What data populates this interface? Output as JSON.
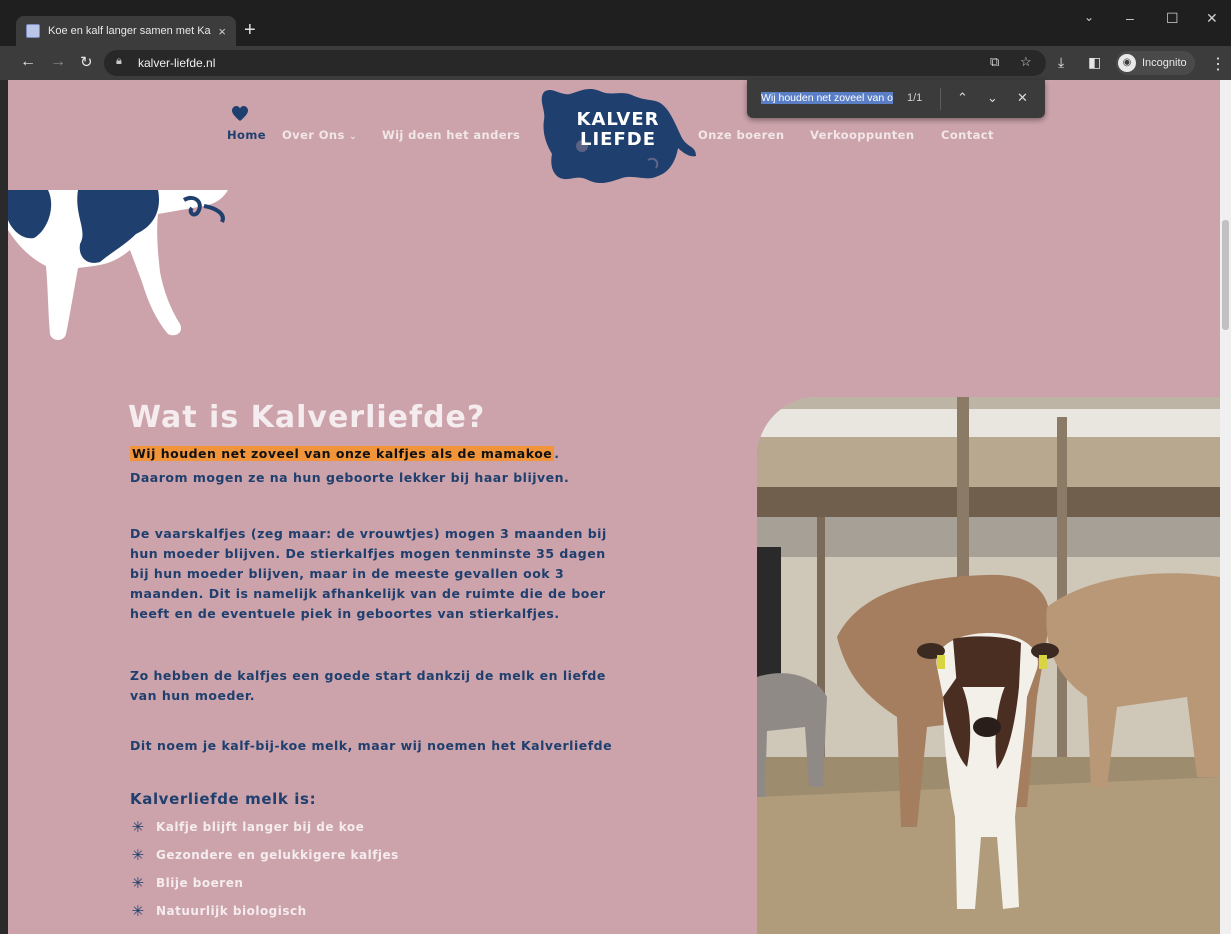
{
  "browser": {
    "tab_title": "Koe en kalf langer samen met Ka",
    "tab_close": "×",
    "new_tab": "+",
    "url": "kalver-liefde.nl",
    "profile_label": "Incognito",
    "window_controls": {
      "dropdown": "⌄",
      "minimize": "–",
      "maximize": "☐",
      "close": "✕"
    }
  },
  "find_bar": {
    "query": "Wij houden net zoveel van o",
    "count": "1/1"
  },
  "nav": {
    "home": "Home",
    "over_ons": "Over Ons",
    "wij_doen": "Wij doen het anders",
    "boeren": "Onze boeren",
    "verkoop": "Verkooppunten",
    "contact": "Contact"
  },
  "logo": {
    "line1": "KALVER",
    "line2": "LIEFDE"
  },
  "content": {
    "heading": "Wat is Kalverliefde?",
    "highlight": "Wij houden net zoveel van onze kalfjes als de mamakoe",
    "highlight_end": ".",
    "p1_line2": "Daarom mogen ze na hun geboorte lekker bij haar blijven.",
    "p2": [
      "De vaarskalfjes (zeg maar: de vrouwtjes) mogen 3 maanden bij",
      "hun moeder blijven. De stierkalfjes mogen tenminste 35 dagen",
      "bij hun moeder blijven, maar in de meeste gevallen ook 3",
      "maanden. Dit is namelijk afhankelijk van de ruimte die de boer",
      "heeft en de eventuele piek in geboortes van stierkalfjes."
    ],
    "p3": [
      "Zo hebben de kalfjes een goede start dankzij de melk en liefde",
      "van hun moeder."
    ],
    "p4": "Dit noem je kalf-bij-koe melk, maar wij noemen het Kalverliefde",
    "list_title": "Kalverliefde melk is:",
    "list": [
      "Kalfje blijft langer bij de koe",
      "Gezondere en gelukkigere kalfjes",
      "Blije boeren",
      "Natuurlijk biologisch"
    ]
  },
  "colors": {
    "page_bg": "#cca3ab",
    "navy": "#1f3f6e",
    "highlight": "#f2953a",
    "light_text": "#f4ecee"
  }
}
